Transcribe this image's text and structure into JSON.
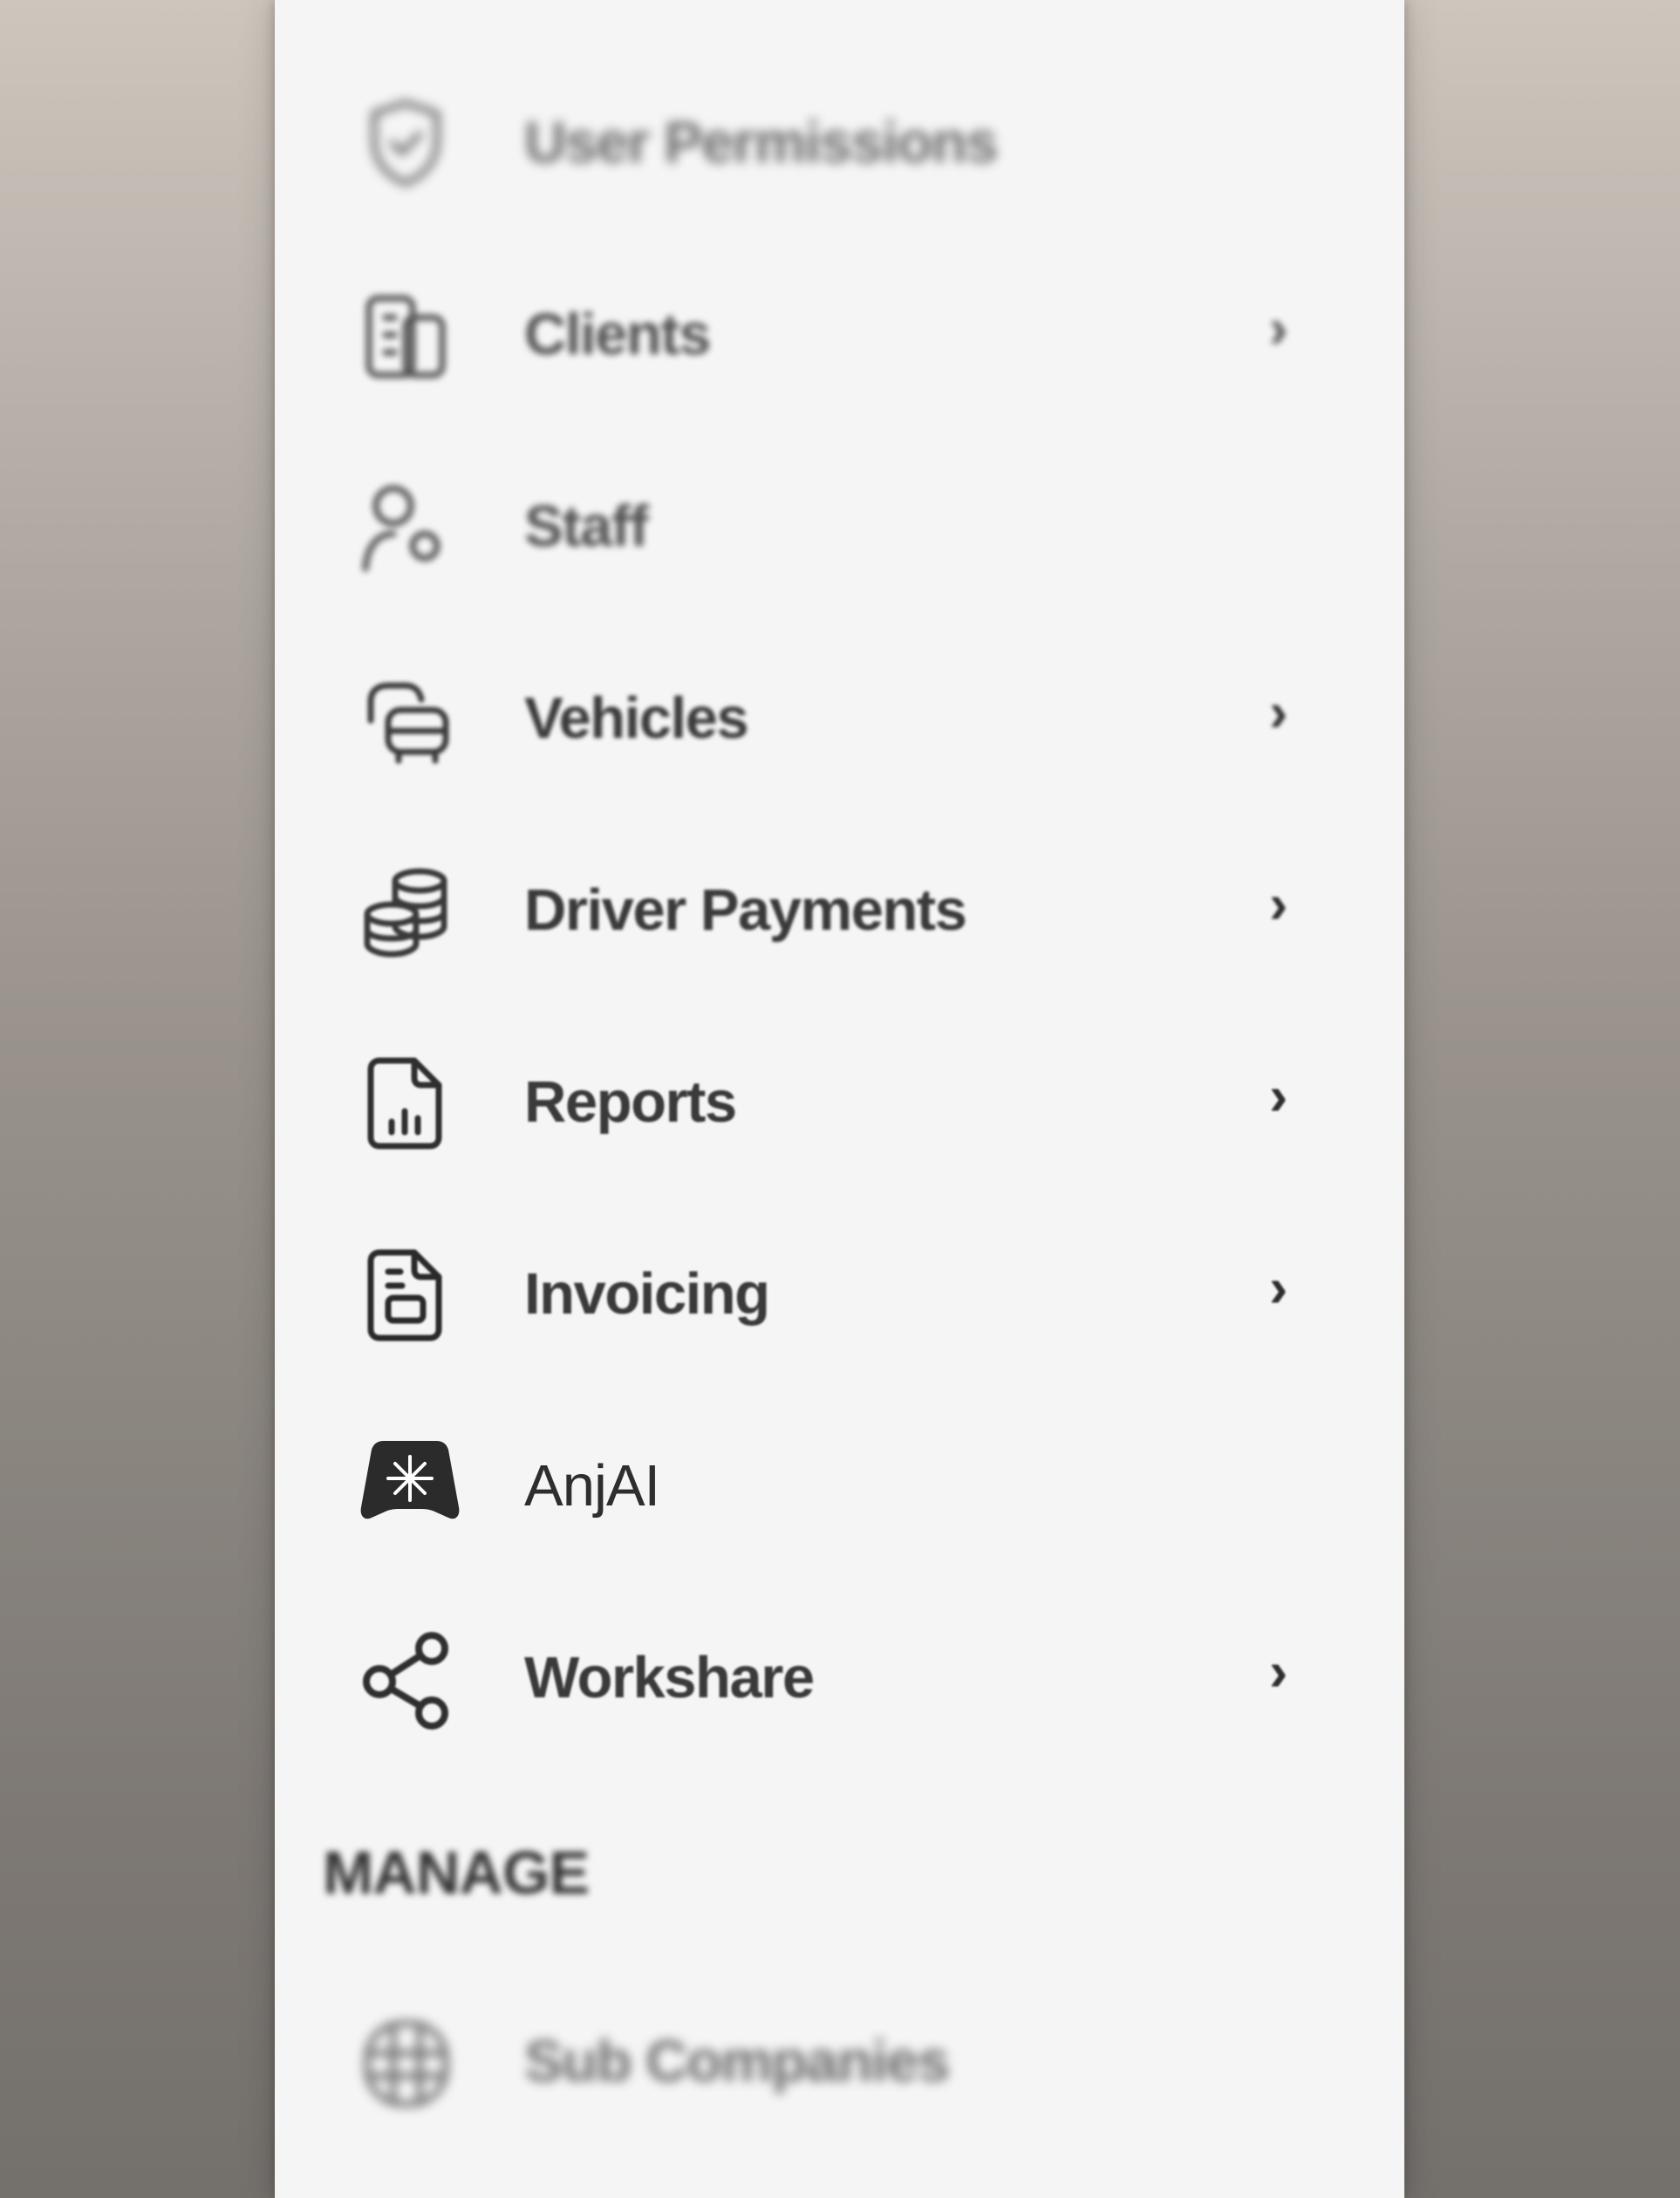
{
  "menu": {
    "items": [
      {
        "label": "User Permissions",
        "icon": "shield-check-icon",
        "has_chevron": false
      },
      {
        "label": "Clients",
        "icon": "buildings-icon",
        "has_chevron": true
      },
      {
        "label": "Staff",
        "icon": "users-icon",
        "has_chevron": false
      },
      {
        "label": "Vehicles",
        "icon": "vehicles-icon",
        "has_chevron": true
      },
      {
        "label": "Driver Payments",
        "icon": "coins-icon",
        "has_chevron": true
      },
      {
        "label": "Reports",
        "icon": "report-chart-icon",
        "has_chevron": true
      },
      {
        "label": "Invoicing",
        "icon": "invoice-icon",
        "has_chevron": true
      },
      {
        "label": "AnjAI",
        "icon": "anjai-logo-icon",
        "has_chevron": false
      },
      {
        "label": "Workshare",
        "icon": "share-nodes-icon",
        "has_chevron": true
      }
    ],
    "chevron_glyph": "›"
  },
  "manage": {
    "header": "MANAGE",
    "items": [
      {
        "label": "Sub Companies",
        "icon": "globe-icon",
        "has_chevron": false
      }
    ]
  },
  "colors": {
    "panel_background": "#f5f5f5",
    "text": "#3a3a3a",
    "icon_fill_dark": "#2b2b2b"
  }
}
